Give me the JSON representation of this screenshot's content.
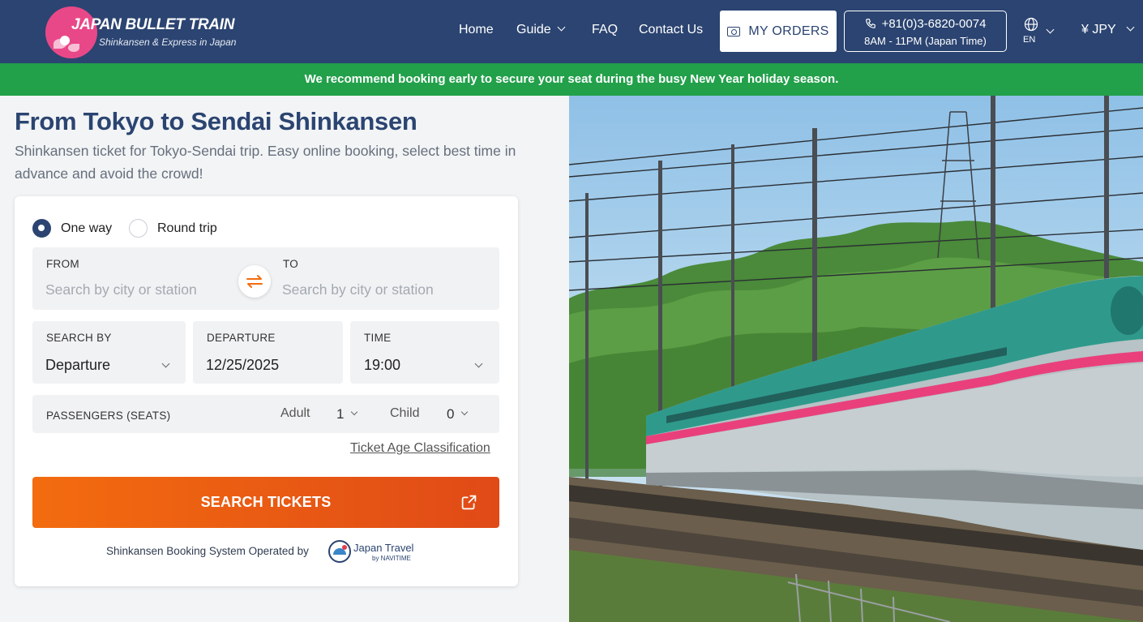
{
  "header": {
    "logo_title": "JAPAN BULLET TRAIN",
    "logo_subtitle": "Shinkansen & Express in Japan",
    "nav": {
      "home": "Home",
      "guide": "Guide",
      "faq": "FAQ",
      "contact": "Contact Us"
    },
    "my_orders": "MY ORDERS",
    "phone": "+81(0)3-6820-0074",
    "phone_hours": "8AM - 11PM (Japan Time)",
    "language": "EN",
    "currency": "¥ JPY"
  },
  "banner": "We recommend booking early to secure your seat during the busy New Year holiday season.",
  "page": {
    "title": "From Tokyo to Sendai Shinkansen",
    "subtitle": "Shinkansen ticket for Tokyo-Sendai trip. Easy online booking, select best time in advance and avoid the crowd!"
  },
  "form": {
    "trip_type": {
      "one_way": "One way",
      "round_trip": "Round trip",
      "selected": "One way"
    },
    "from": {
      "label": "FROM",
      "placeholder": "Search by city or station",
      "value": ""
    },
    "to": {
      "label": "TO",
      "placeholder": "Search by city or station",
      "value": ""
    },
    "search_by": {
      "label": "SEARCH BY",
      "value": "Departure"
    },
    "departure": {
      "label": "DEPARTURE",
      "value": "12/25/2025"
    },
    "time": {
      "label": "TIME",
      "value": "19:00"
    },
    "passengers": {
      "label": "PASSENGERS (SEATS)",
      "adult_label": "Adult",
      "adult_value": "1",
      "child_label": "Child",
      "child_value": "0"
    },
    "age_link": "Ticket Age Classification",
    "search_button": "SEARCH TICKETS",
    "operated_by": "Shinkansen Booking System Operated by",
    "operator_name": "Japan Travel",
    "operator_by": "by NAVITIME"
  },
  "colors": {
    "header_bg": "#2b4471",
    "banner_bg": "#22a04a",
    "accent_orange": "#f36c0f",
    "title_navy": "#2b4471"
  }
}
